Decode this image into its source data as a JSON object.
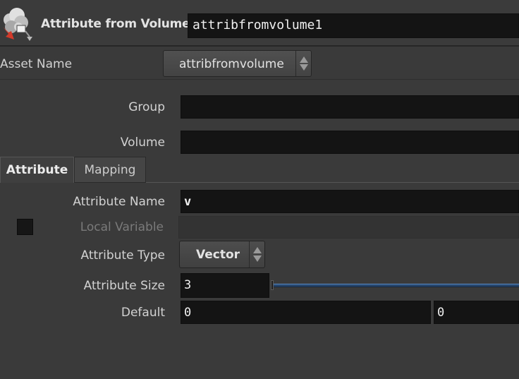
{
  "header": {
    "node_type": "Attribute from Volume",
    "node_name": "attribfromvolume1",
    "icon": "volume-cloud-icon"
  },
  "asset": {
    "label": "Asset Name",
    "value": "attribfromvolume"
  },
  "params": {
    "group_label": "Group",
    "group_value": "",
    "volume_label": "Volume",
    "volume_value": ""
  },
  "tabs": [
    {
      "label": "Attribute",
      "active": true
    },
    {
      "label": "Mapping",
      "active": false
    }
  ],
  "attribute": {
    "name_label": "Attribute Name",
    "name_value": "v",
    "local_var_label": "Local Variable",
    "local_var_checked": false,
    "type_label": "Attribute Type",
    "type_value": "Vector",
    "size_label": "Attribute Size",
    "size_value": "3",
    "default_label": "Default",
    "default_values": [
      "0",
      "0"
    ]
  },
  "colors": {
    "background": "#3a3a3a",
    "field": "#141414",
    "slider_accent": "#27476e"
  }
}
